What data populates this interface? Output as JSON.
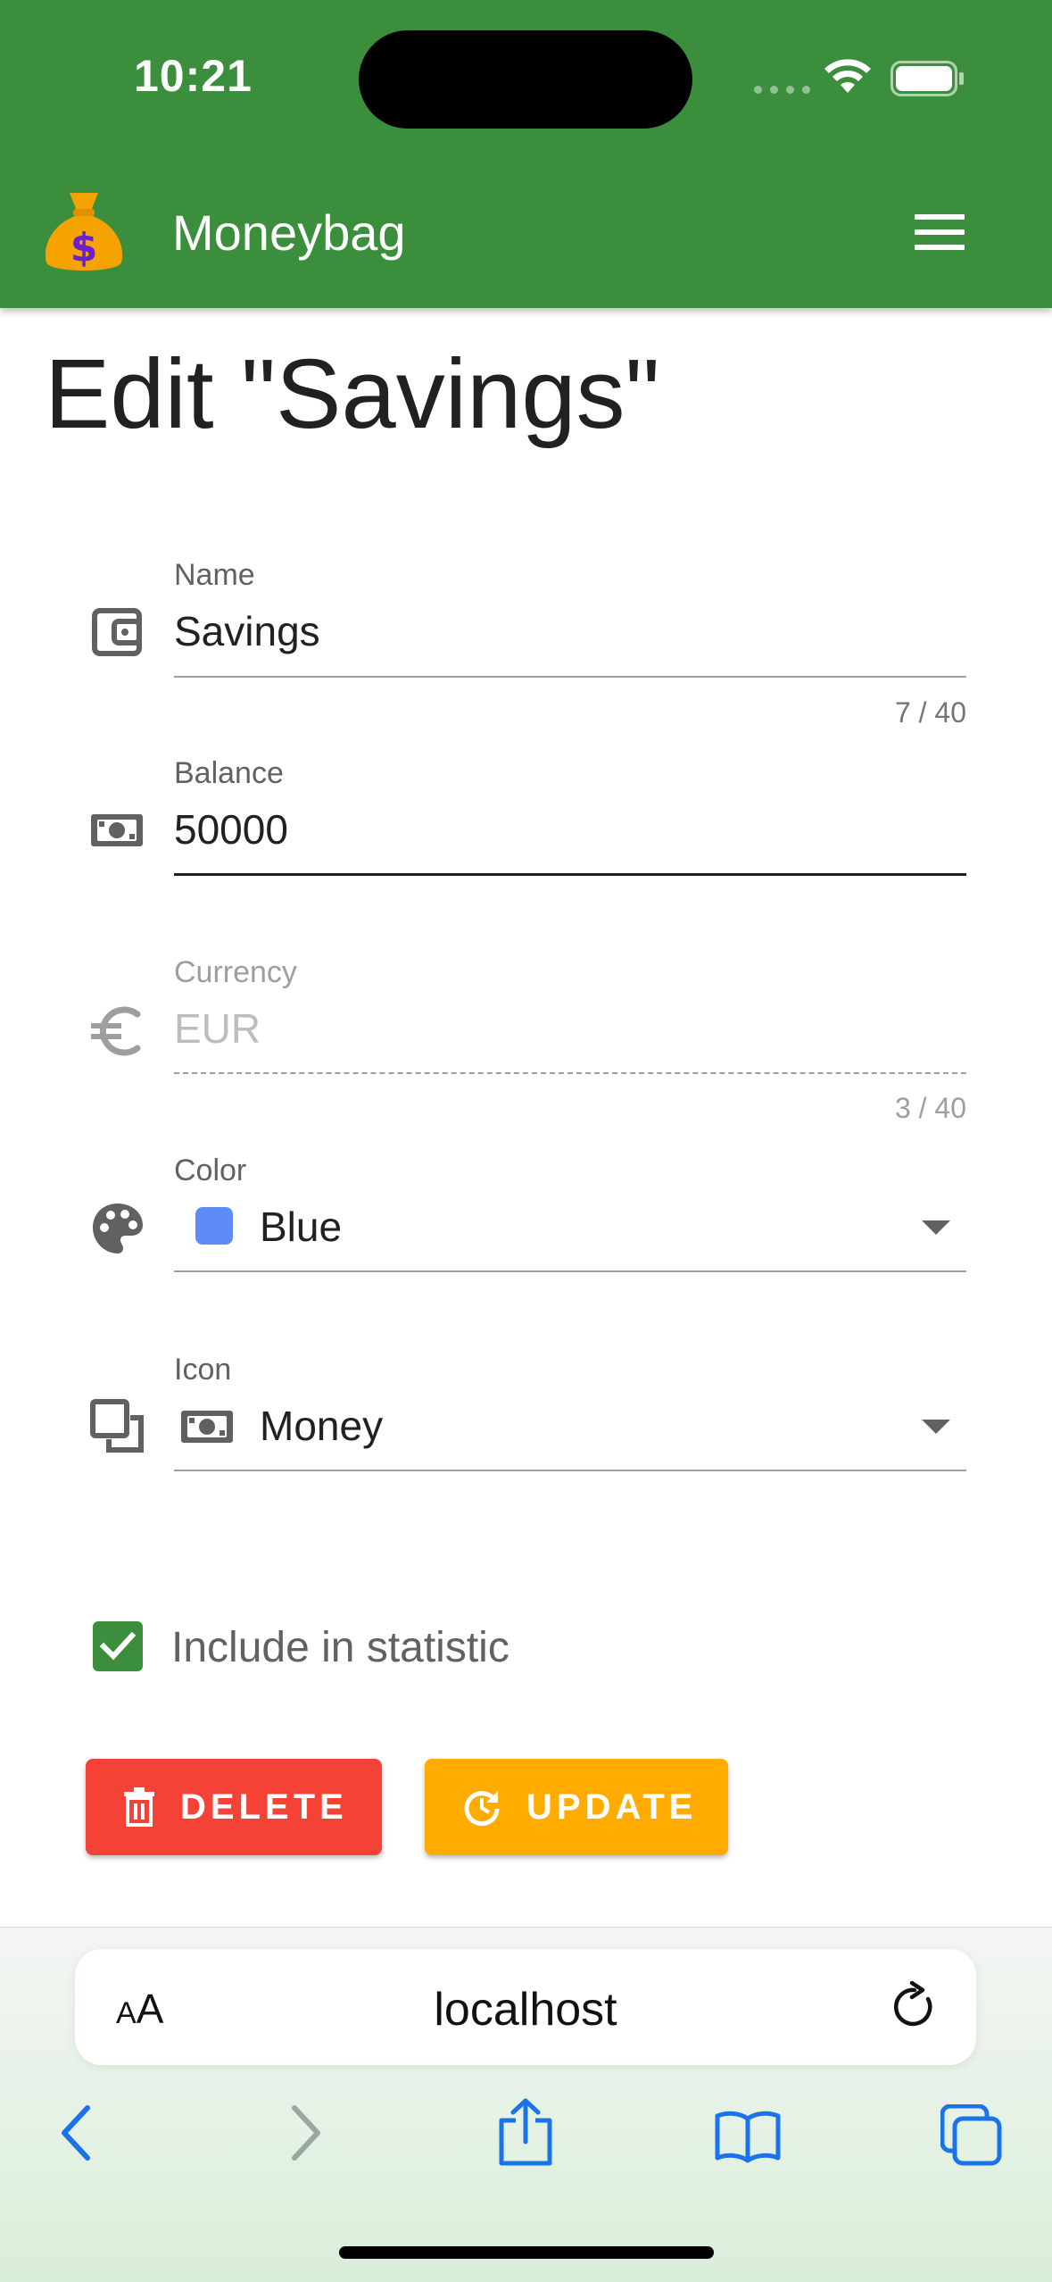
{
  "status_bar": {
    "time": "10:21"
  },
  "app_bar": {
    "title": "Moneybag",
    "logo_icon": "money-bag-icon",
    "menu_icon": "hamburger-menu-icon",
    "color": "#3b8f3c"
  },
  "page": {
    "title": "Edit \"Savings\""
  },
  "form": {
    "name": {
      "label": "Name",
      "value": "Savings",
      "counter": "7 / 40",
      "icon": "wallet-icon"
    },
    "balance": {
      "label": "Balance",
      "value": "50000",
      "icon": "money-icon"
    },
    "currency": {
      "label": "Currency",
      "value": "EUR",
      "counter": "3 / 40",
      "icon": "euro-icon",
      "disabled": true
    },
    "color": {
      "label": "Color",
      "value": "Blue",
      "swatch": "#5f8bf8",
      "icon": "palette-icon"
    },
    "icon_select": {
      "label": "Icon",
      "value": "Money",
      "icon": "copy-icon",
      "value_icon": "money-icon"
    },
    "include_in_statistic": {
      "label": "Include in statistic",
      "checked": true
    }
  },
  "actions": {
    "delete_label": "DELETE",
    "update_label": "UPDATE",
    "delete_color": "#f44336",
    "update_color": "#ffab00"
  },
  "browser": {
    "aa_big": "A",
    "aa_small": "A",
    "url": "localhost"
  }
}
